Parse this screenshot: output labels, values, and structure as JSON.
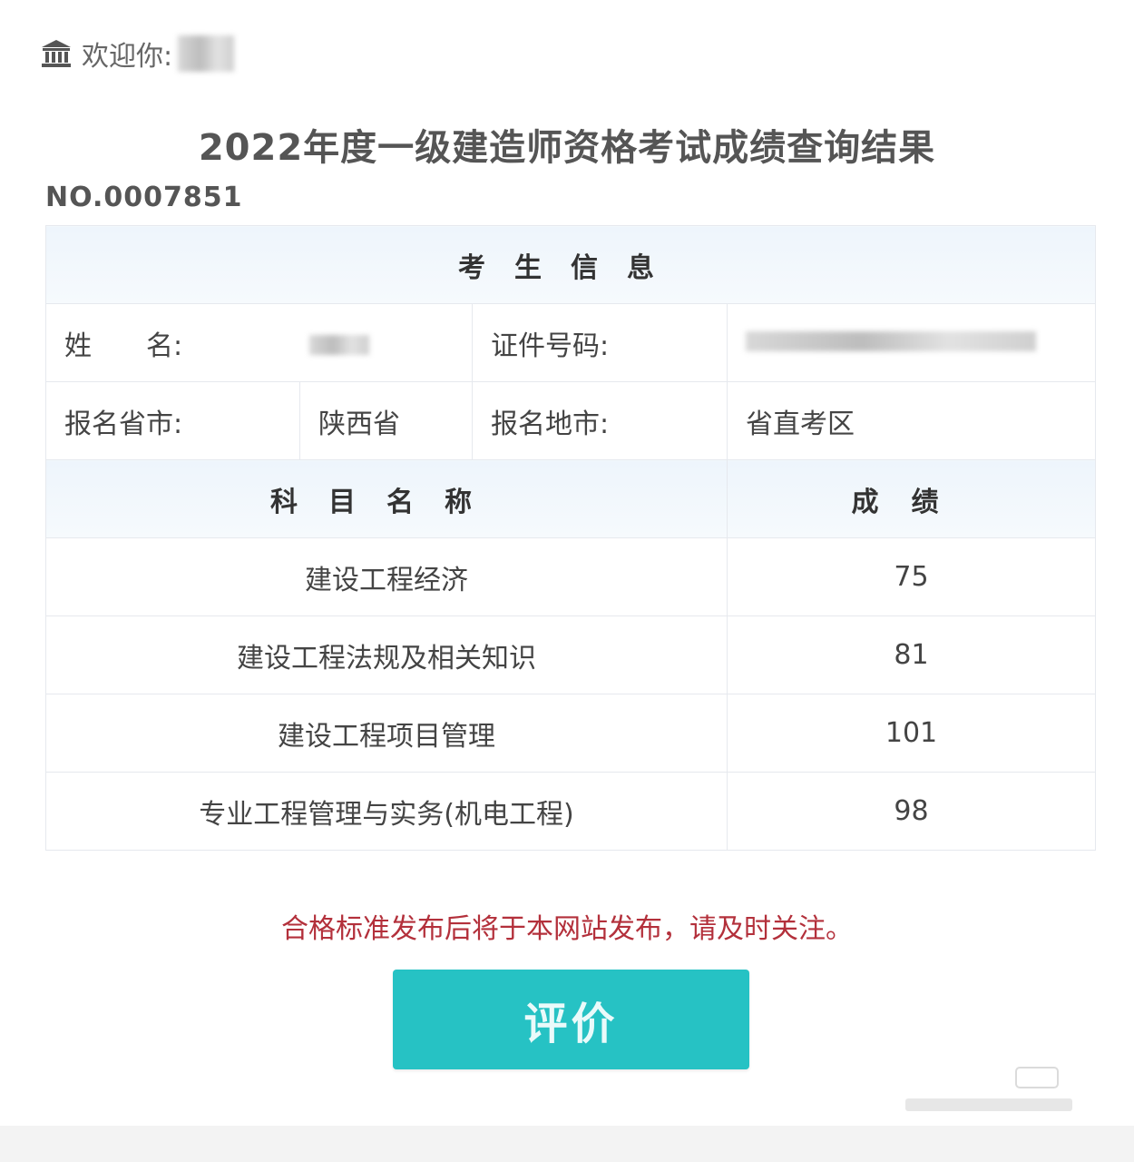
{
  "header": {
    "welcome_label": "欢迎你:",
    "icon": "bank-icon"
  },
  "page": {
    "title": "2022年度一级建造师资格考试成绩查询结果",
    "serial_no": "NO.0007851"
  },
  "candidate": {
    "section_title": "考生信息",
    "name_label_1": "姓",
    "name_label_2": "名:",
    "id_label": "证件号码:",
    "province_label": "报名省市:",
    "province_value": "陕西省",
    "city_label": "报名地市:",
    "city_value": "省直考区"
  },
  "scores": {
    "subject_header": "科目名称",
    "score_header": "成绩",
    "rows": [
      {
        "subject": "建设工程经济",
        "score": "75"
      },
      {
        "subject": "建设工程法规及相关知识",
        "score": "81"
      },
      {
        "subject": "建设工程项目管理",
        "score": "101"
      },
      {
        "subject": "专业工程管理与实务(机电工程)",
        "score": "98"
      }
    ]
  },
  "notice": "合格标准发布后将于本网站发布，请及时关注。",
  "actions": {
    "rate_label": "评价"
  },
  "colors": {
    "button": "#26c2c4",
    "notice": "#b3303b",
    "header_bg": "#eef5fc"
  }
}
